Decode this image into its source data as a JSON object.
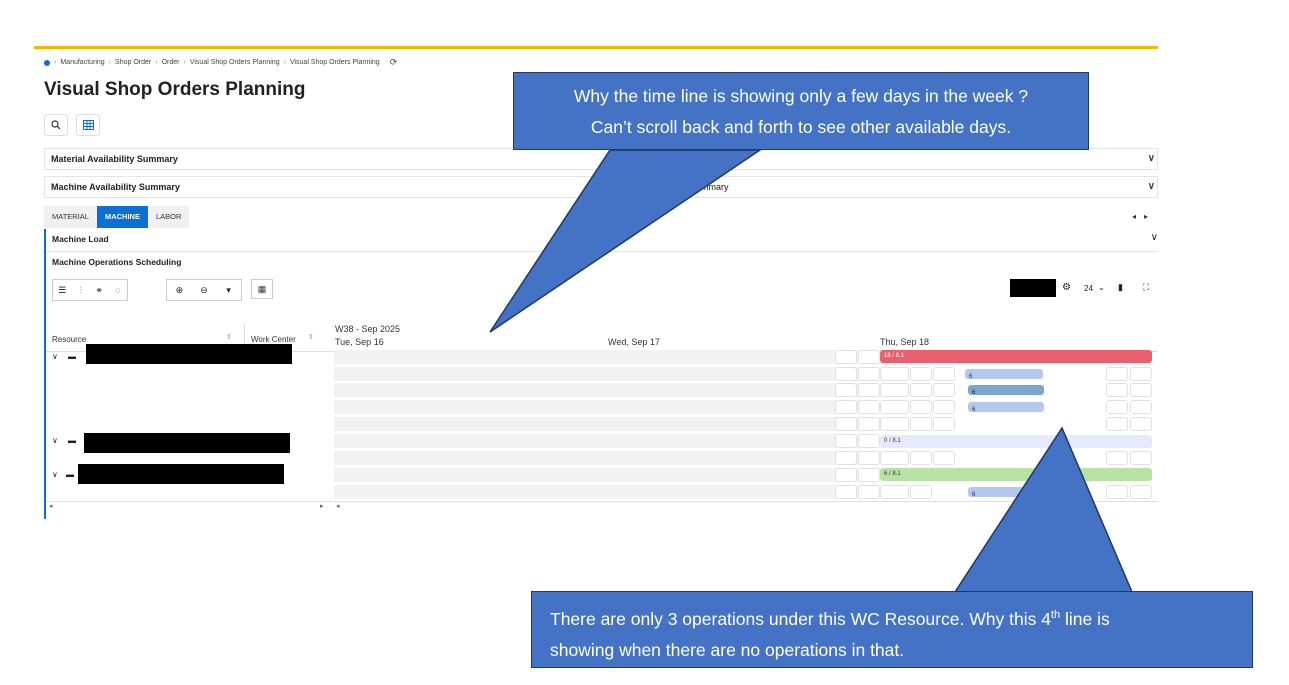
{
  "breadcrumb": [
    "Manufacturing",
    "Shop Order",
    "Order",
    "Visual Shop Orders Planning",
    "Visual Shop Orders Planning"
  ],
  "page_title": "Visual Shop Orders Planning",
  "sections": {
    "material_availability": "Material Availability Summary",
    "machine_availability": "Machine Availability Summary",
    "machine_availability_suffix": "mmary"
  },
  "tabs": [
    "MATERIAL",
    "MACHINE",
    "LABOR"
  ],
  "machine_load": "Machine Load",
  "machine_operations_scheduling": "Machine Operations Scheduling",
  "zoom_value": "24",
  "grid": {
    "col_resource": "Resource",
    "col_work_center": "Work Center",
    "week": "W38 - Sep 2025",
    "days": [
      "Tue, Sep 16",
      "Wed, Sep 17",
      "Thu, Sep 18"
    ]
  },
  "bars": {
    "load1": "18 / 8.1",
    "load2": "0 / 8.1",
    "load3": "6 / 8.1",
    "op": "6"
  },
  "colors": {
    "accent": "#0a6fd6",
    "overload": "#e8606e",
    "underload": "#e6e8fb",
    "ok": "#b7e2a5",
    "op": "#b4c7ee",
    "op_selected": "#7aa7cc",
    "callout": "#4472c4"
  },
  "callouts": {
    "top_line1": "Why the time line is showing only a few days in the week ?",
    "top_line2": "Can’t scroll back and forth to see other available days.",
    "bottom_line1_a": "There are only 3 operations under this WC Resource. Why this 4",
    "bottom_line1_sup": "th",
    "bottom_line1_b": " line is",
    "bottom_line2": "showing when there are no operations in that."
  }
}
